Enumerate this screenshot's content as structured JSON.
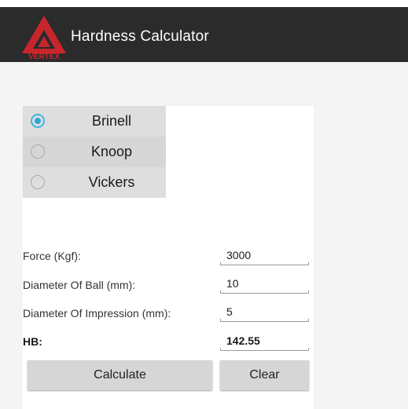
{
  "app": {
    "title": "Hardness Calculator",
    "logo_text": "VERTEX",
    "brand_color": "#c8262c",
    "appbar_color": "#2b2b2b"
  },
  "methods": {
    "selected": "Brinell",
    "options": [
      {
        "label": "Brinell",
        "checked": true
      },
      {
        "label": "Knoop",
        "checked": false
      },
      {
        "label": "Vickers",
        "checked": false
      }
    ],
    "accent_color": "#2ea8dc"
  },
  "form": {
    "force": {
      "label": "Force (Kgf):",
      "value": "3000"
    },
    "ball_diameter": {
      "label": "Diameter Of Ball (mm):",
      "value": "10"
    },
    "impression_diameter": {
      "label": "Diameter Of Impression (mm):",
      "value": "5"
    },
    "result": {
      "label": "HB:",
      "value": "142.55"
    }
  },
  "buttons": {
    "calculate": "Calculate",
    "clear": "Clear"
  }
}
